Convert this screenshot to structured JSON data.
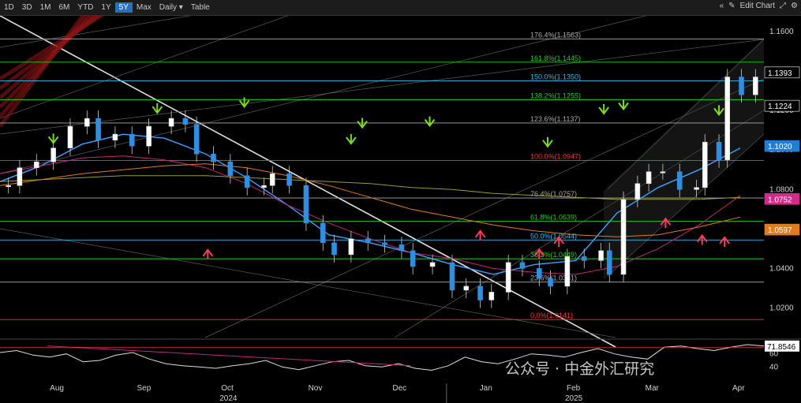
{
  "toolbar": {
    "ranges": [
      "1D",
      "3D",
      "1M",
      "6M",
      "YTD",
      "1Y",
      "5Y",
      "Max"
    ],
    "active_range": "5Y",
    "frequency": "Daily",
    "table_label": "Table",
    "edit_label": "Edit Chart",
    "icons": [
      "collapse-icon",
      "pencil-icon",
      "expand-icon",
      "settings-icon"
    ]
  },
  "colors": {
    "candle": "#2f8fe0",
    "ma_fast": "#3fa0ff",
    "ma_mid": "#c0287a",
    "ma_slow": "#e07b20",
    "ma_long": "#9a9a30",
    "fib_red": "#ff3333",
    "fib_green": "#22cc22",
    "fib_cyan": "#33bbee",
    "fib_gray": "#aaaaaa",
    "arrow_up": "#ff3b5c",
    "arrow_down": "#7bdc1e",
    "rsi": "#dddddd"
  },
  "watermark": "公众号 · 中金外汇研究",
  "chart_data": {
    "type": "line",
    "instrument_style": "candlestick",
    "frequency": "Daily",
    "x_ticks": [
      "Aug",
      "Sep",
      "Oct",
      "Nov",
      "Dec",
      "Jan",
      "Feb",
      "Mar",
      "Apr"
    ],
    "x_years": [
      {
        "label": "2024",
        "under": "Oct"
      },
      {
        "label": "2025",
        "under": "Feb"
      }
    ],
    "y_ticks": [
      1.02,
      1.04,
      1.06,
      1.08,
      1.1,
      1.12,
      1.14,
      1.16
    ],
    "y_tick_labels": [
      "1.0200",
      "1.0400",
      "1.0600",
      "1.0800",
      "1.1000",
      "1.1200",
      "1.1400",
      "1.1600"
    ],
    "ylim": [
      1.005,
      1.168
    ],
    "series": [
      {
        "x": [
          "2024-07-29",
          "2024-08-02",
          "2024-08-08",
          "2024-08-14",
          "2024-08-20",
          "2024-08-26",
          "2024-08-30",
          "2024-09-05",
          "2024-09-11",
          "2024-09-17",
          "2024-09-25",
          "2024-09-30",
          "2024-10-04",
          "2024-10-10",
          "2024-10-16",
          "2024-10-22",
          "2024-10-28",
          "2024-10-31",
          "2024-11-06",
          "2024-11-12",
          "2024-11-18",
          "2024-11-22",
          "2024-11-28",
          "2024-12-04",
          "2024-12-10",
          "2024-12-16",
          "2024-12-20",
          "2024-12-27",
          "2025-01-03",
          "2025-01-08",
          "2025-01-13",
          "2025-01-17",
          "2025-01-23",
          "2025-01-28",
          "2025-02-03",
          "2025-02-07",
          "2025-02-13",
          "2025-02-19",
          "2025-02-25",
          "2025-02-28",
          "2025-03-05",
          "2025-03-10",
          "2025-03-14",
          "2025-03-19",
          "2025-03-25",
          "2025-03-31",
          "2025-04-03",
          "2025-04-08",
          "2025-04-11",
          "2025-04-16",
          "2025-04-21"
        ],
        "close": [
          1.082,
          1.091,
          1.094,
          1.101,
          1.112,
          1.116,
          1.105,
          1.108,
          1.102,
          1.112,
          1.116,
          1.113,
          1.098,
          1.094,
          1.087,
          1.081,
          1.082,
          1.088,
          1.082,
          1.063,
          1.053,
          1.047,
          1.055,
          1.053,
          1.052,
          1.049,
          1.041,
          1.043,
          1.029,
          1.031,
          1.024,
          1.028,
          1.043,
          1.04,
          1.035,
          1.031,
          1.046,
          1.044,
          1.049,
          1.037,
          1.075,
          1.083,
          1.089,
          1.089,
          1.08,
          1.081,
          1.104,
          1.095,
          1.137,
          1.128,
          1.137
        ],
        "name": ""
      }
    ],
    "moving_averages": [
      {
        "color_key": "ma_fast",
        "values": [
          1.084,
          1.092,
          1.103,
          1.108,
          1.106,
          1.098,
          1.086,
          1.072,
          1.057,
          1.053,
          1.048,
          1.042,
          1.037,
          1.042,
          1.044,
          1.068,
          1.081,
          1.09,
          1.101
        ]
      },
      {
        "color_key": "ma_mid",
        "values": [
          1.088,
          1.092,
          1.096,
          1.097,
          1.095,
          1.091,
          1.083,
          1.072,
          1.063,
          1.055,
          1.048,
          1.045,
          1.04,
          1.038,
          1.037,
          1.041,
          1.05,
          1.062,
          1.077
        ]
      },
      {
        "color_key": "ma_slow",
        "values": [
          1.082,
          1.085,
          1.088,
          1.09,
          1.092,
          1.093,
          1.091,
          1.087,
          1.082,
          1.076,
          1.07,
          1.066,
          1.062,
          1.059,
          1.057,
          1.056,
          1.057,
          1.061,
          1.066
        ]
      },
      {
        "color_key": "ma_long",
        "values": [
          1.084,
          1.085,
          1.086,
          1.087,
          1.087,
          1.087,
          1.086,
          1.085,
          1.084,
          1.083,
          1.081,
          1.08,
          1.078,
          1.077,
          1.076,
          1.075,
          1.075,
          1.075,
          1.076
        ]
      }
    ],
    "fib_levels": [
      {
        "label": "176.4%(1.1563)",
        "value": 1.1563,
        "color_key": "fib_gray"
      },
      {
        "label": "161.8%(1.1445)",
        "value": 1.1445,
        "color_key": "fib_green"
      },
      {
        "label": "150.0%(1.1350)",
        "value": 1.135,
        "color_key": "fib_cyan"
      },
      {
        "label": "138.2%(1.1255)",
        "value": 1.1255,
        "color_key": "fib_green"
      },
      {
        "label": "123.6%(1.1137)",
        "value": 1.1137,
        "color_key": "fib_gray"
      },
      {
        "label": "100.0%(1.0947)",
        "value": 1.0947,
        "color_key": "fib_red"
      },
      {
        "label": "76.4%(1.0757)",
        "value": 1.0757,
        "color_key": "fib_gray"
      },
      {
        "label": "61.8%(1.0639)",
        "value": 1.0639,
        "color_key": "fib_green"
      },
      {
        "label": "50.0%(1.0544)",
        "value": 1.0544,
        "color_key": "fib_cyan"
      },
      {
        "label": "38.2%(1.0449)",
        "value": 1.0449,
        "color_key": "fib_green"
      },
      {
        "label": "23.6%(1.0331)",
        "value": 1.0331,
        "color_key": "fib_gray"
      },
      {
        "label": "0.0%(1.0141)",
        "value": 1.0141,
        "color_key": "fib_red"
      }
    ],
    "price_tags": [
      {
        "label": "1.1393",
        "value": 1.1393,
        "style": "white"
      },
      {
        "label": "1.1224",
        "value": 1.1224,
        "style": "white"
      },
      {
        "label": "1.1020",
        "value": 1.102,
        "style": "blue"
      },
      {
        "label": "1.0752",
        "value": 1.0752,
        "style": "magenta"
      },
      {
        "label": "1.0597",
        "value": 1.0597,
        "style": "orange"
      }
    ],
    "arrows": [
      {
        "x": "2024-08-14",
        "dir": "down"
      },
      {
        "x": "2024-09-20",
        "dir": "down"
      },
      {
        "x": "2024-10-08",
        "dir": "up"
      },
      {
        "x": "2024-10-21",
        "dir": "down"
      },
      {
        "x": "2024-11-28",
        "dir": "down"
      },
      {
        "x": "2024-12-02",
        "dir": "down"
      },
      {
        "x": "2024-12-26",
        "dir": "down"
      },
      {
        "x": "2025-01-13",
        "dir": "up"
      },
      {
        "x": "2025-02-06",
        "dir": "down"
      },
      {
        "x": "2025-02-03",
        "dir": "up"
      },
      {
        "x": "2025-02-10",
        "dir": "up"
      },
      {
        "x": "2025-02-26",
        "dir": "down"
      },
      {
        "x": "2025-03-05",
        "dir": "down"
      },
      {
        "x": "2025-03-20",
        "dir": "up"
      },
      {
        "x": "2025-04-02",
        "dir": "up"
      },
      {
        "x": "2025-04-08",
        "dir": "down"
      },
      {
        "x": "2025-04-10",
        "dir": "up"
      }
    ],
    "rsi": {
      "current_label": "71.8546",
      "current": 71.85,
      "y_ticks": [
        60,
        40
      ],
      "values": [
        62,
        65,
        58,
        55,
        60,
        48,
        50,
        58,
        62,
        52,
        45,
        42,
        40,
        38,
        42,
        45,
        50,
        40,
        36,
        42,
        48,
        50,
        42,
        40,
        45,
        38,
        35,
        42,
        55,
        48,
        45,
        52,
        60,
        58,
        55,
        62,
        68,
        60,
        55,
        52,
        70,
        72,
        68,
        65,
        70,
        74,
        72
      ]
    }
  }
}
